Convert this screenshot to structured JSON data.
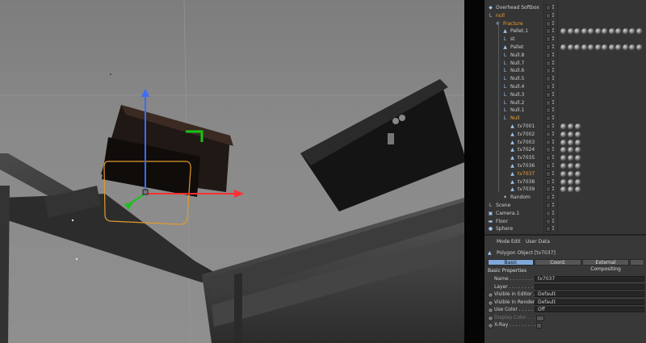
{
  "colors": {
    "selected": "#f0a030",
    "text": "#cfcfcf",
    "axis_x": "#ff3030",
    "axis_y": "#3a6cff",
    "axis_z": "#18c418",
    "accent_tab": "#7fa8d8"
  },
  "object_manager": {
    "rows": [
      {
        "name": "Overhead Softbox",
        "icon": "light-icon",
        "level": 0,
        "selected": false
      },
      {
        "name": "null",
        "icon": "null-icon",
        "level": 0,
        "selected": true
      },
      {
        "name": "Fracture",
        "icon": "fracture-icon",
        "level": 1,
        "selected": true
      },
      {
        "name": "Pallet.1",
        "icon": "polygon-icon",
        "level": 2,
        "selected": false
      },
      {
        "name": "st",
        "icon": "null-icon",
        "level": 2,
        "selected": false
      },
      {
        "name": "Pallet",
        "icon": "polygon-icon",
        "level": 2,
        "selected": false
      },
      {
        "name": "Null.8",
        "icon": "null-icon",
        "level": 2,
        "selected": false
      },
      {
        "name": "Null.7",
        "icon": "null-icon",
        "level": 2,
        "selected": false
      },
      {
        "name": "Null.6",
        "icon": "null-icon",
        "level": 2,
        "selected": false
      },
      {
        "name": "Null.5",
        "icon": "null-icon",
        "level": 2,
        "selected": false
      },
      {
        "name": "Null.4",
        "icon": "null-icon",
        "level": 2,
        "selected": false
      },
      {
        "name": "Null.3",
        "icon": "null-icon",
        "level": 2,
        "selected": false
      },
      {
        "name": "Null.2",
        "icon": "null-icon",
        "level": 2,
        "selected": false
      },
      {
        "name": "Null.1",
        "icon": "null-icon",
        "level": 2,
        "selected": false
      },
      {
        "name": "Null",
        "icon": "null-icon",
        "level": 2,
        "selected": true
      },
      {
        "name": "tv7001",
        "icon": "polygon-icon",
        "level": 3,
        "selected": false
      },
      {
        "name": "tv7002",
        "icon": "polygon-icon",
        "level": 3,
        "selected": false
      },
      {
        "name": "tv7003",
        "icon": "polygon-icon",
        "level": 3,
        "selected": false
      },
      {
        "name": "tv7024",
        "icon": "polygon-icon",
        "level": 3,
        "selected": false
      },
      {
        "name": "tv7035",
        "icon": "polygon-icon",
        "level": 3,
        "selected": false
      },
      {
        "name": "tv7036",
        "icon": "polygon-icon",
        "level": 3,
        "selected": false
      },
      {
        "name": "tv7037",
        "icon": "polygon-icon",
        "level": 3,
        "selected": true
      },
      {
        "name": "tv7038",
        "icon": "polygon-icon",
        "level": 3,
        "selected": false
      },
      {
        "name": "tv7039",
        "icon": "polygon-icon",
        "level": 3,
        "selected": false
      },
      {
        "name": "Random",
        "icon": "effector-icon",
        "level": 2,
        "selected": false
      },
      {
        "name": "Scene",
        "icon": "null-icon",
        "level": 0,
        "selected": false
      },
      {
        "name": "Camera.1",
        "icon": "camera-icon",
        "level": 0,
        "selected": false
      },
      {
        "name": "Floor",
        "icon": "floor-icon",
        "level": 0,
        "selected": false
      },
      {
        "name": "Sphere",
        "icon": "sphere-icon",
        "level": 0,
        "selected": false
      }
    ]
  },
  "attribute_manager": {
    "menu": [
      "Mode",
      "Edit",
      "User Data"
    ],
    "object_title": "Polygon Object [tv7037]",
    "tabs": [
      {
        "label": "Basic",
        "active": true
      },
      {
        "label": "Coord.",
        "active": false
      },
      {
        "label": "External Compositing",
        "active": false
      }
    ],
    "section_title": "Basic Properties",
    "properties": [
      {
        "label": "Name . . . . . . . . . . .",
        "value": "tv7037",
        "disabled": false,
        "radio": false
      },
      {
        "label": "Layer . . . . . . . . . . .",
        "value": "",
        "disabled": false,
        "radio": false
      },
      {
        "label": "Visible in Editor . .",
        "value": "Default",
        "disabled": false,
        "radio": true
      },
      {
        "label": "Visible in Renderer",
        "value": "Default",
        "disabled": false,
        "radio": true
      },
      {
        "label": "Use Color . . . . . . .",
        "value": "Off",
        "disabled": false,
        "radio": true
      },
      {
        "label": "Display Color . . . .",
        "value": "",
        "disabled": true,
        "radio": true
      },
      {
        "label": "X-Ray . . . . . . . . . .",
        "value": "",
        "disabled": false,
        "radio": true
      }
    ]
  }
}
